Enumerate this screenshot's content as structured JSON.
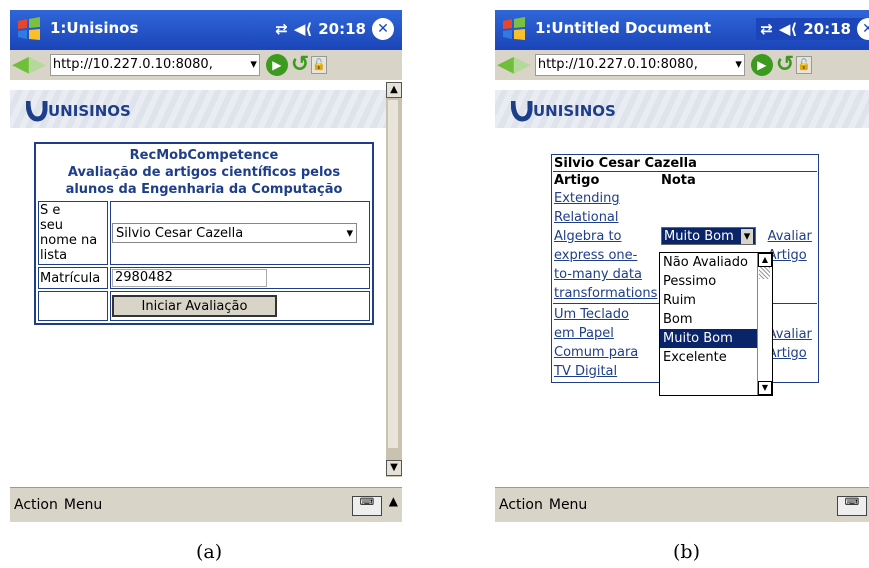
{
  "screens": {
    "a": {
      "caption": "(a)",
      "window_title": "1:Unisinos",
      "time": "20:18",
      "url": "http://10.227.0.10:8080,",
      "logo_text": "UNISINOS",
      "form": {
        "title_line1": "RecMobCompetence",
        "title_line2": "Avaliação de artigos científicos pelos",
        "title_line3": "alunos da Engenharia da Computação",
        "name_label_1": "S       e",
        "name_label_2": "seu",
        "name_label_3": "nome na",
        "name_label_4": "lista",
        "name_selected": "Silvio Cesar Cazella",
        "matricula_label": "Matrícula",
        "matricula_value": "2980482",
        "start_button": "Iniciar Avaliação"
      },
      "menubar": {
        "left": "Action",
        "right": "Menu"
      }
    },
    "b": {
      "caption": "(b)",
      "window_title": "1:Untitled Document",
      "time": "20:18",
      "url": "http://10.227.0.10:8080,",
      "logo_text": "UNISINOS",
      "table": {
        "student_name": "Silvio Cesar Cazella",
        "col_artigo": "Artigo",
        "col_nota": "Nota",
        "article1_lines": [
          "Extending",
          "Relational",
          "Algebra to",
          "express one-",
          "to-many data",
          "transformations"
        ],
        "article2_lines": [
          "Um Teclado",
          "em Papel",
          "Comum para",
          "TV Digital"
        ],
        "select_value": "Muito Bom",
        "avaliar_1": "Avaliar",
        "artigo_1": "Artigo",
        "avaliar_2": "Avaliar",
        "artigo_2": "Artigo"
      },
      "dropdown_options": [
        "Não Avaliado",
        "Pessimo",
        "Ruim",
        "Bom",
        "Muito Bom",
        "Excelente"
      ],
      "selected_option_index": 4,
      "menubar": {
        "left": "Action",
        "right": "Menu"
      }
    }
  },
  "icons": {
    "windows": "windows-start-icon",
    "connectivity": "connectivity-icon",
    "volume": "speaker-icon",
    "close": "close-icon",
    "back": "back-arrow-icon",
    "forward": "forward-arrow-icon",
    "go": "go-icon",
    "refresh": "refresh-icon",
    "lock": "lock-icon",
    "keyboard": "keyboard-icon"
  },
  "colors": {
    "titlebar": "#1b45b8",
    "link": "#1f3e8a",
    "selection": "#0a246a"
  }
}
